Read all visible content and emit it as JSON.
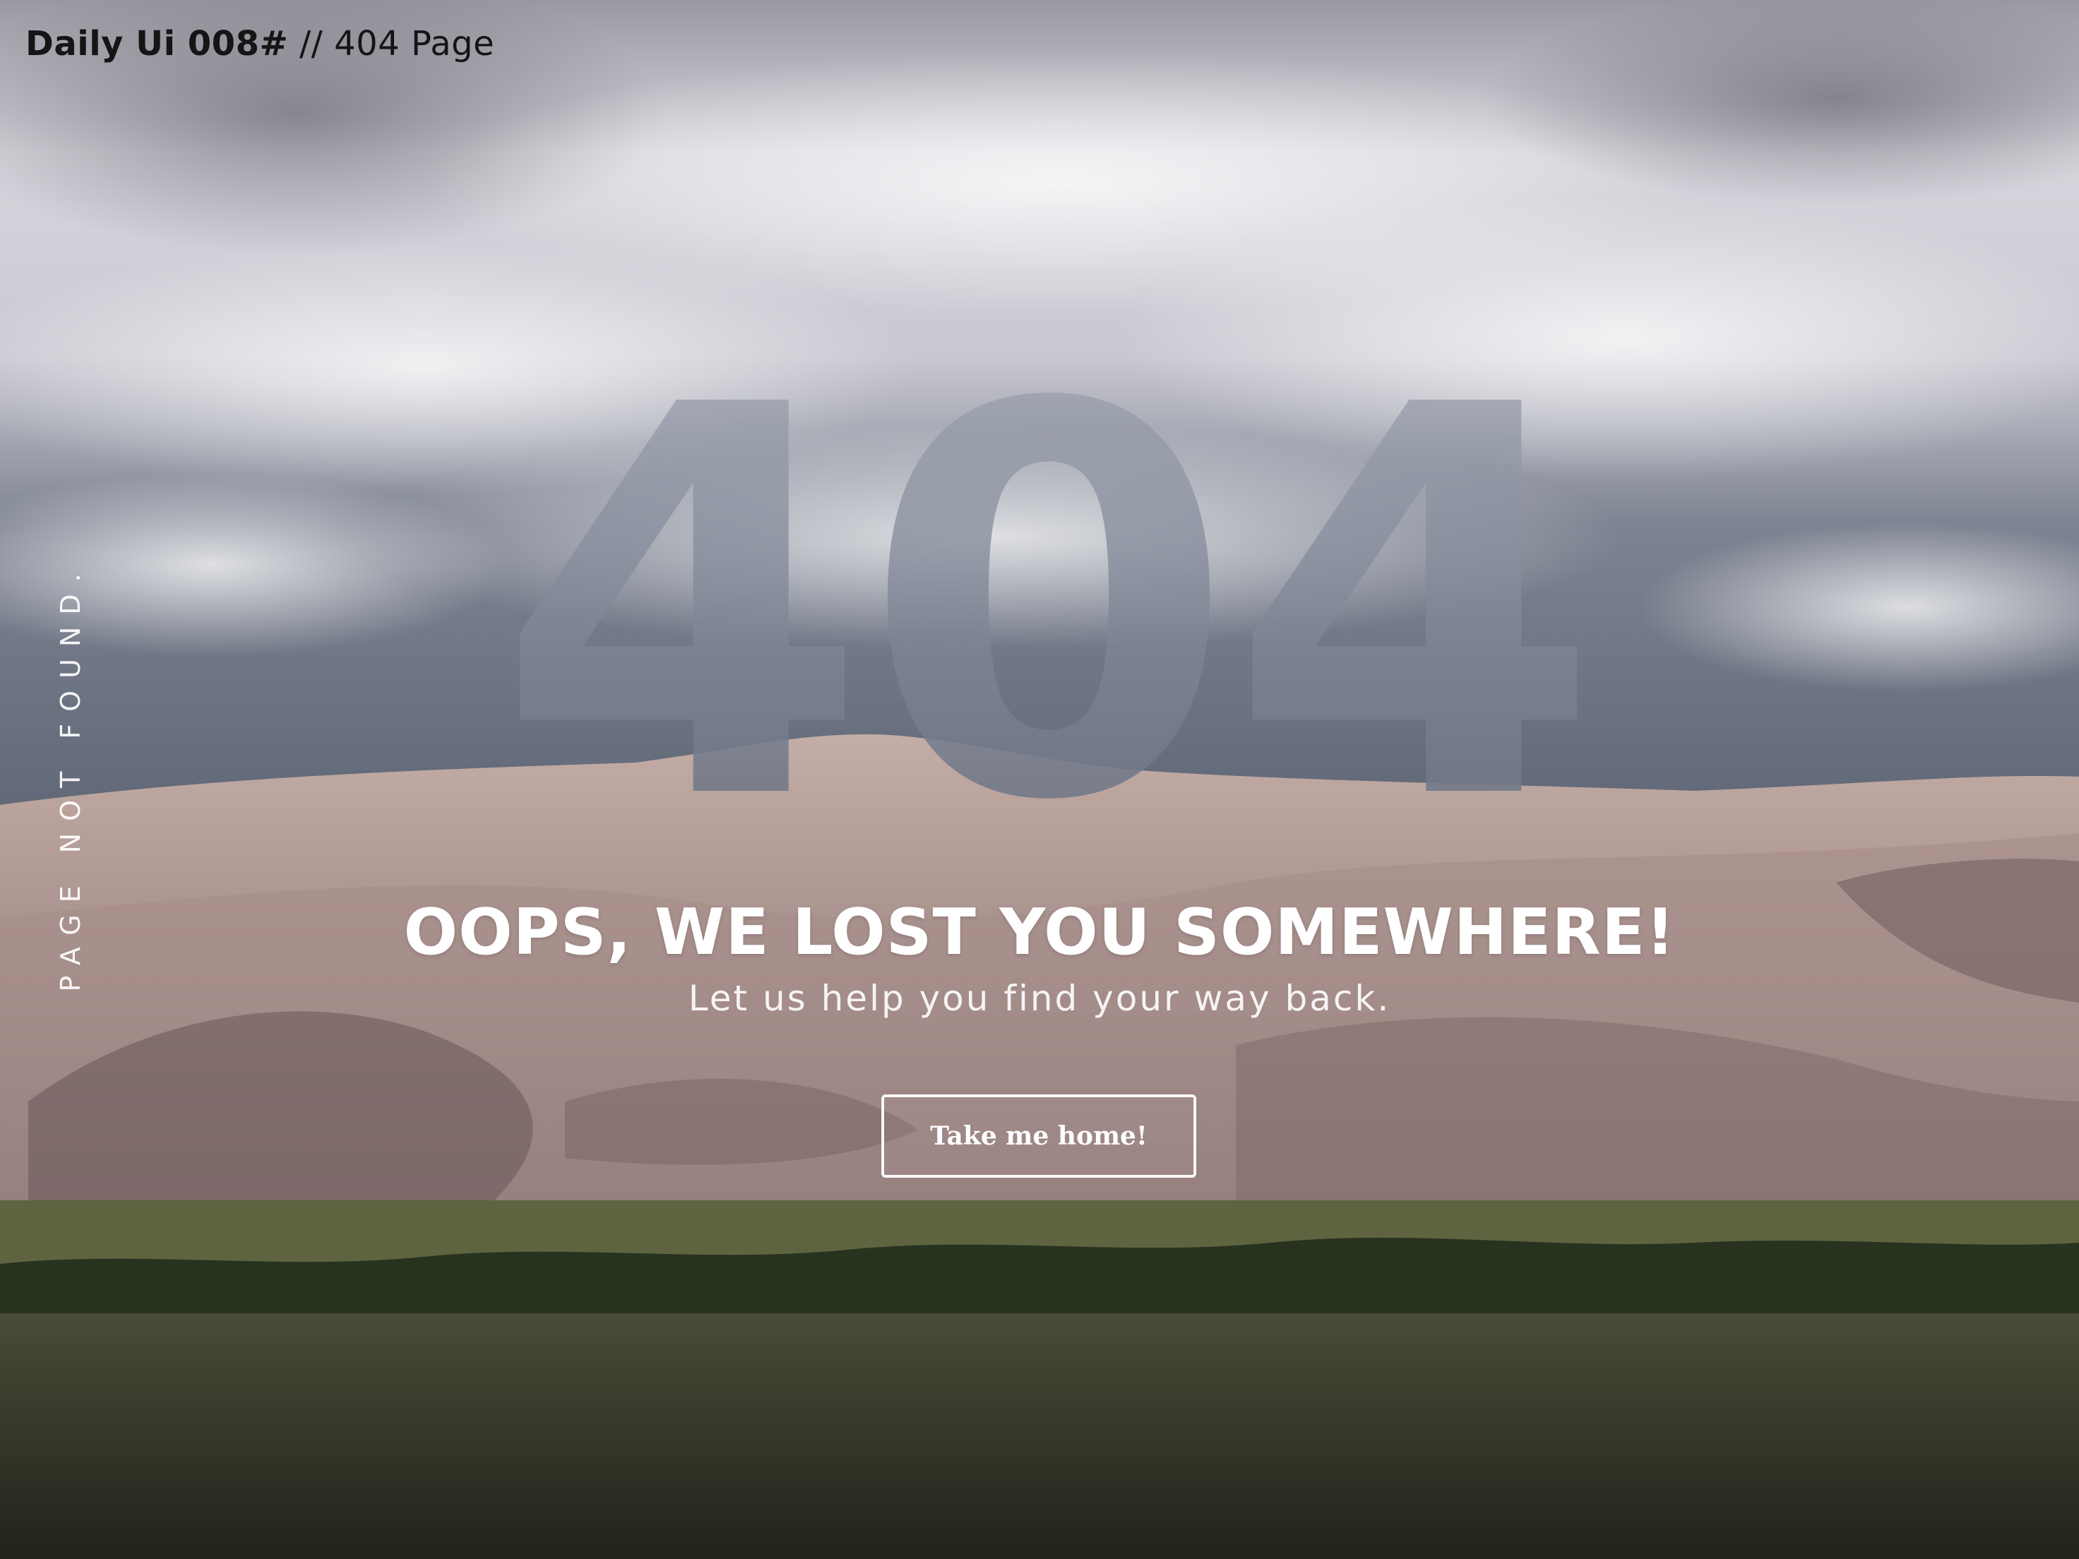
{
  "header": {
    "title_strong": "Daily Ui 008#",
    "title_light": " // 404 Page"
  },
  "side": {
    "label": "PAGE NOT FOUND."
  },
  "hero": {
    "code": "404",
    "headline": "OOPS, WE LOST YOU SOMEWHERE!",
    "subline": "Let us help you find your way back.",
    "button_label": "Take me home!"
  },
  "colors": {
    "sky_top": "#8f8c96",
    "sky_mid": "#cfcdd6",
    "dune": "#b59e9a",
    "dune_shadow": "#6f5b5a",
    "grass": "#5c6140",
    "trees": "#1f2a1e",
    "ground": "#262a1f",
    "code_fill": "#73798a"
  }
}
